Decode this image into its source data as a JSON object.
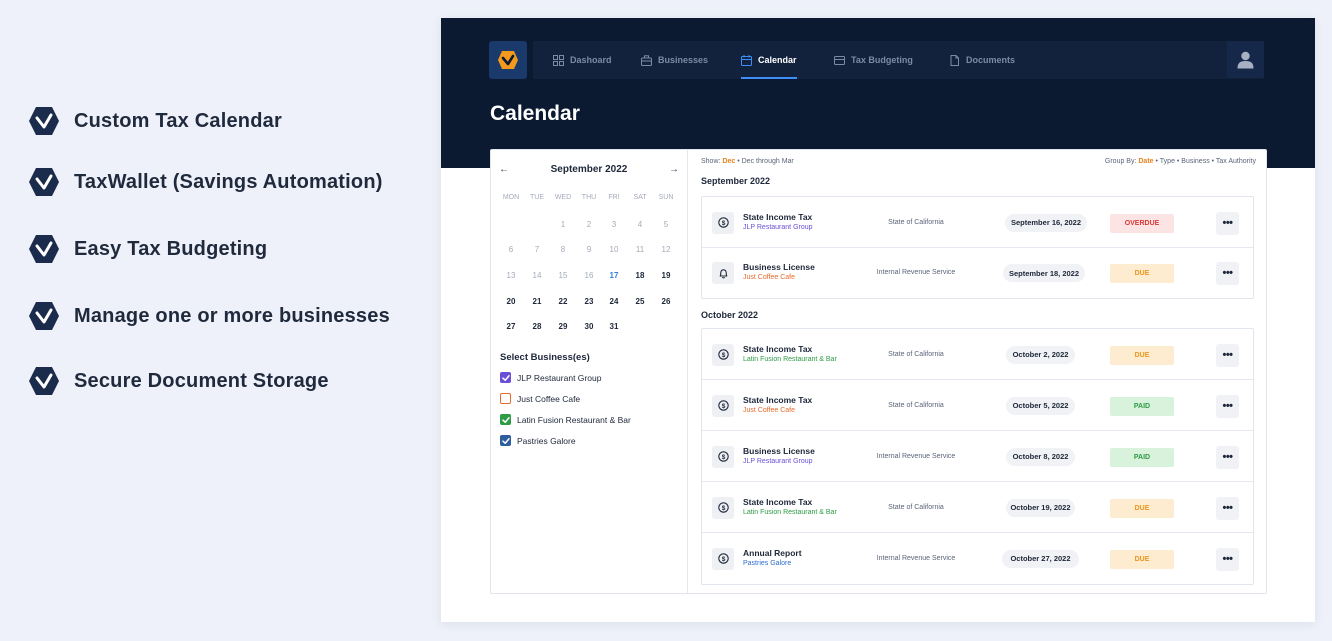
{
  "features": [
    "Custom Tax Calendar",
    "TaxWallet (Savings Automation)",
    "Easy Tax Budgeting",
    "Manage one or more businesses",
    "Secure Document Storage"
  ],
  "nav": {
    "items": [
      {
        "label": "Dashoard",
        "icon": "grid-icon"
      },
      {
        "label": "Businesses",
        "icon": "briefcase-icon"
      },
      {
        "label": "Calendar",
        "icon": "calendar-icon",
        "active": true
      },
      {
        "label": "Tax Budgeting",
        "icon": "card-icon"
      },
      {
        "label": "Documents",
        "icon": "document-icon"
      }
    ],
    "logo_icon": "chevron-logo-icon",
    "user_icon": "user-icon"
  },
  "page_title": "Calendar",
  "calendar": {
    "month_label": "September 2022",
    "prev_label": "←",
    "next_label": "→",
    "weekdays": [
      "MON",
      "TUE",
      "WED",
      "THU",
      "FRI",
      "SAT",
      "SUN"
    ],
    "weeks": [
      [
        "",
        "",
        "1",
        "2",
        "3",
        "4",
        "5"
      ],
      [
        "6",
        "7",
        "8",
        "9",
        "10",
        "11",
        "12"
      ],
      [
        "13",
        "14",
        "15",
        "16",
        "17",
        "18",
        "19"
      ],
      [
        "20",
        "21",
        "22",
        "23",
        "24",
        "25",
        "26"
      ],
      [
        "27",
        "28",
        "29",
        "30",
        "31",
        "",
        ""
      ]
    ],
    "marked_dates": {
      "16": "#4a5bd6",
      "18": "#d93737"
    },
    "today": "17"
  },
  "businesses": {
    "title": "Select Business(es)",
    "items": [
      {
        "label": "JLP Restaurant Group",
        "color": "#6a4fd6",
        "checked": true
      },
      {
        "label": "Just Coffee Cafe",
        "color": "#e8692a",
        "checked": false
      },
      {
        "label": "Latin Fusion Restaurant & Bar",
        "color": "#2e9c45",
        "checked": true
      },
      {
        "label": "Pastries Galore",
        "color": "#2d5f9e",
        "checked": true
      }
    ]
  },
  "filters": {
    "show_label": "Show:",
    "show_active": "Dec",
    "show_rest": "• Dec through Mar",
    "group_label": "Group By:",
    "group_active": "Date",
    "group_rest": "• Type • Business • Tax Authority"
  },
  "sections": [
    {
      "title": "September 2022",
      "rows": [
        {
          "title": "State Income Tax",
          "business": "JLP Restaurant Group",
          "business_color": "#6a4fd6",
          "authority": "State of California",
          "date": "September 16, 2022",
          "status": "OVERDUE",
          "status_type": "overdue",
          "icon": "dollar-icon"
        },
        {
          "title": "Business License",
          "business": "Just Coffee Cafe",
          "business_color": "#e8692a",
          "authority": "Internal Revenue Service",
          "date": "September 18, 2022",
          "status": "DUE",
          "status_type": "due",
          "icon": "bell-icon"
        }
      ]
    },
    {
      "title": "October 2022",
      "rows": [
        {
          "title": "State Income Tax",
          "business": "Latin Fusion Restaurant & Bar",
          "business_color": "#2e9c45",
          "authority": "State of California",
          "date": "October 2, 2022",
          "status": "DUE",
          "status_type": "due",
          "icon": "dollar-icon"
        },
        {
          "title": "State Income Tax",
          "business": "Just Coffee Cafe",
          "business_color": "#e8692a",
          "authority": "State of California",
          "date": "October 5, 2022",
          "status": "PAID",
          "status_type": "paid",
          "icon": "dollar-icon"
        },
        {
          "title": "Business License",
          "business": "JLP Restaurant Group",
          "business_color": "#6a4fd6",
          "authority": "Internal Revenue Service",
          "date": "October 8, 2022",
          "status": "PAID",
          "status_type": "paid",
          "icon": "dollar-icon"
        },
        {
          "title": "State Income Tax",
          "business": "Latin Fusion Restaurant & Bar",
          "business_color": "#2e9c45",
          "authority": "State of California",
          "date": "October 19, 2022",
          "status": "DUE",
          "status_type": "due",
          "icon": "dollar-icon"
        },
        {
          "title": "Annual Report",
          "business": "Pastries Galore",
          "business_color": "#2d6fd0",
          "authority": "Internal Revenue Service",
          "date": "October 27, 2022",
          "status": "DUE",
          "status_type": "due",
          "icon": "dollar-icon"
        }
      ]
    }
  ],
  "more_label": "•••"
}
